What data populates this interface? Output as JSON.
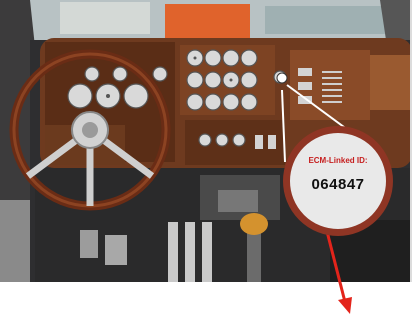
{
  "photo": {
    "subject": "semi-truck-dashboard",
    "colors": {
      "wood": "#7a3b1d",
      "wood_dark": "#4a2410",
      "chrome": "#c9c9c9",
      "callout_border": "#8f3524",
      "callout_title": "#c61f1f",
      "arrow": "#e3241b"
    }
  },
  "callout": {
    "title": "ECM-Linked ID:",
    "value": "064847"
  }
}
